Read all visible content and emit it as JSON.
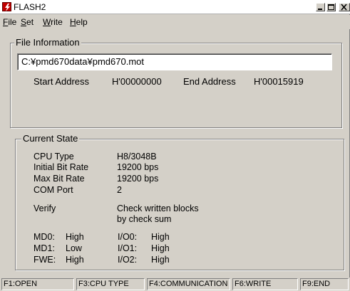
{
  "window": {
    "title": "FLASH2"
  },
  "menu": [
    {
      "mnemonic": "F",
      "rest": "ile"
    },
    {
      "mnemonic": "S",
      "rest": "et"
    },
    {
      "mnemonic": "W",
      "rest": "rite"
    },
    {
      "mnemonic": "H",
      "rest": "elp"
    }
  ],
  "file_info": {
    "group_label": "File Information",
    "path": "C:¥pmd670data¥pmd670.mot",
    "start_label": "Start Address",
    "start_value": "H'00000000",
    "end_label": "End Address",
    "end_value": "H'00015919"
  },
  "current_state": {
    "group_label": "Current State",
    "rows": [
      {
        "label": "CPU Type",
        "value": "H8/3048B"
      },
      {
        "label": "Initial Bit Rate",
        "value": "19200 bps"
      },
      {
        "label": "Max Bit Rate",
        "value": "19200 bps"
      },
      {
        "label": "COM Port",
        "value": "2"
      }
    ],
    "verify_label": "Verify",
    "verify_value_1": "Check written blocks",
    "verify_value_2": "by check sum",
    "pins": [
      {
        "left_label": "MD0:",
        "left_value": "High",
        "right_label": "I/O0:",
        "right_value": "High"
      },
      {
        "left_label": "MD1:",
        "left_value": "Low",
        "right_label": "I/O1:",
        "right_value": "High"
      },
      {
        "left_label": "FWE:",
        "left_value": "High",
        "right_label": "I/O2:",
        "right_value": "High"
      }
    ]
  },
  "status_bar": [
    "F1:OPEN",
    "F3:CPU TYPE",
    "F4:COMMUNICATION",
    "F6:WRITE",
    "F9:END"
  ],
  "icons": {
    "app": "flash-bolt-icon",
    "minimize": "minimize-icon",
    "maximize": "maximize-icon",
    "close": "close-icon"
  },
  "colors": {
    "face": "#d4d0c8",
    "app_icon": "#c00000"
  }
}
